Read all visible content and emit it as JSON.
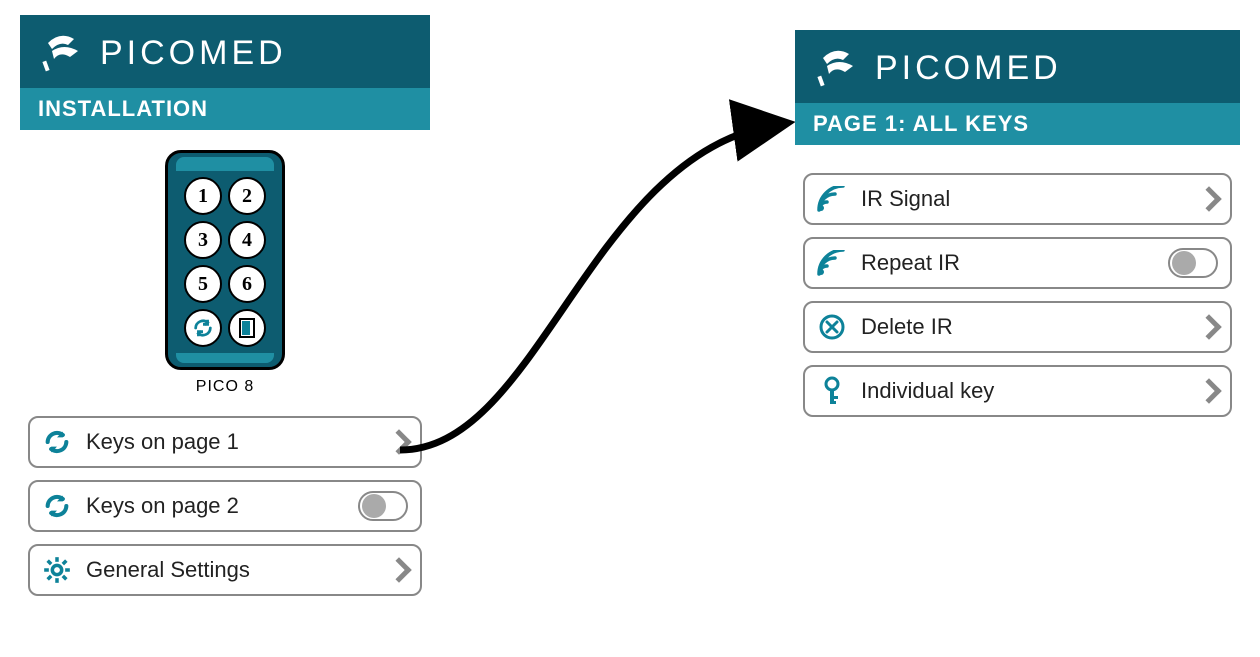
{
  "brand": {
    "name": "PICOMED"
  },
  "left": {
    "subtitle": "INSTALLATION",
    "device_label": "PICO 8",
    "keys": [
      "1",
      "2",
      "3",
      "4",
      "5",
      "6"
    ],
    "menu": [
      {
        "label": "Keys on page 1",
        "icon": "rotate",
        "tail": "chevron"
      },
      {
        "label": "Keys on page 2",
        "icon": "rotate",
        "tail": "toggle"
      },
      {
        "label": "General Settings",
        "icon": "gear",
        "tail": "chevron"
      }
    ]
  },
  "right": {
    "subtitle": "PAGE 1: ALL KEYS",
    "menu": [
      {
        "label": "IR Signal",
        "icon": "signal",
        "tail": "chevron"
      },
      {
        "label": "Repeat IR",
        "icon": "signal",
        "tail": "toggle"
      },
      {
        "label": "Delete IR",
        "icon": "x-circle",
        "tail": "chevron"
      },
      {
        "label": "Individual key",
        "icon": "key",
        "tail": "chevron"
      }
    ]
  }
}
